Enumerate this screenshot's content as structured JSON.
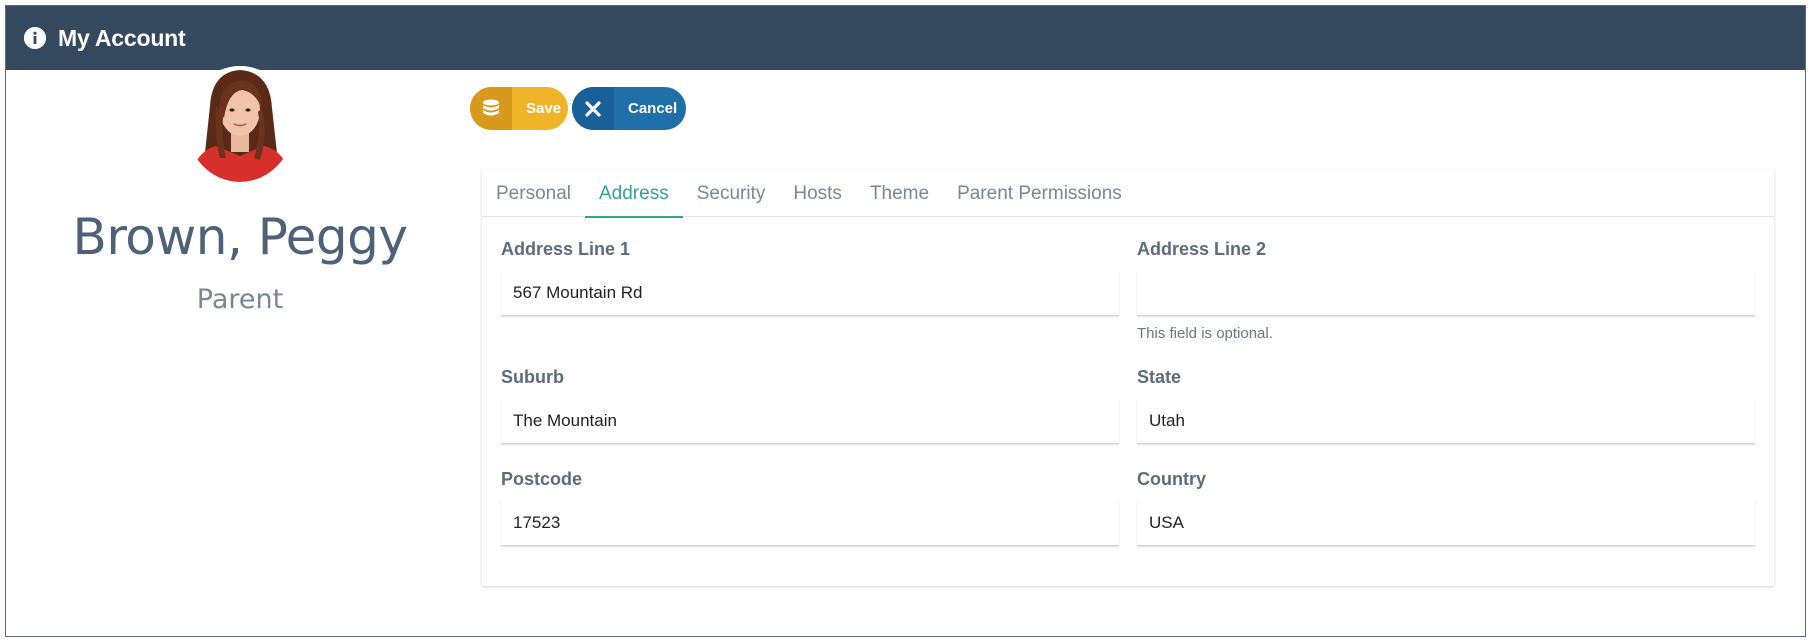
{
  "header": {
    "title": "My Account",
    "icon": "info-icon",
    "background": "#34495e"
  },
  "profile": {
    "name": "Brown, Peggy",
    "role": "Parent",
    "avatar_icon": "avatar"
  },
  "toolbar": {
    "save_label": "Save",
    "save_icon": "database-icon",
    "save_color": "#f0b429",
    "cancel_label": "Cancel",
    "cancel_icon": "close-icon",
    "cancel_color": "#1f6fa8"
  },
  "tabs": [
    {
      "label": "Personal",
      "active": false
    },
    {
      "label": "Address",
      "active": true
    },
    {
      "label": "Security",
      "active": false
    },
    {
      "label": "Hosts",
      "active": false
    },
    {
      "label": "Theme",
      "active": false
    },
    {
      "label": "Parent Permissions",
      "active": false
    }
  ],
  "accent_color": "#2fa58f",
  "form": {
    "address_line_1": {
      "label": "Address Line 1",
      "value": "567 Mountain Rd"
    },
    "address_line_2": {
      "label": "Address Line 2",
      "value": "",
      "help": "This field is optional."
    },
    "suburb": {
      "label": "Suburb",
      "value": "The Mountain"
    },
    "state": {
      "label": "State",
      "value": "Utah"
    },
    "postcode": {
      "label": "Postcode",
      "value": "17523"
    },
    "country": {
      "label": "Country",
      "value": "USA"
    }
  }
}
